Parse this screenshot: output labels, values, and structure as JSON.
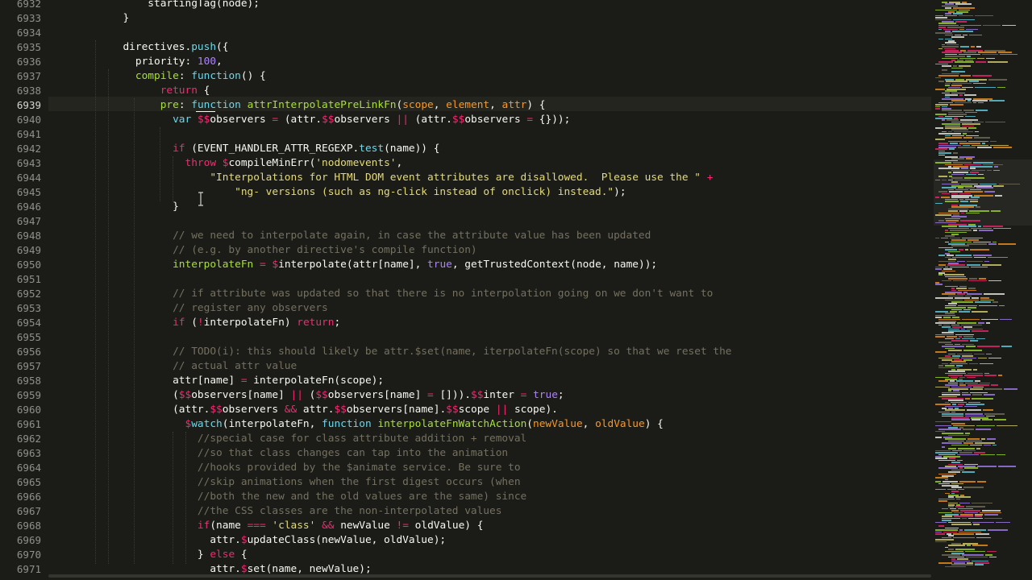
{
  "editor": {
    "active_line": "6939",
    "lines": [
      {
        "n": "6932",
        "t": [
          [
            "                ",
            "t-sel"
          ],
          [
            "startingTag(node);",
            ""
          ]
        ]
      },
      {
        "n": "6933",
        "t": [
          [
            "            }",
            ""
          ]
        ]
      },
      {
        "n": "6934",
        "t": []
      },
      {
        "n": "6935",
        "t": [
          [
            "            directives.",
            ""
          ],
          [
            "push",
            "t-sk"
          ],
          [
            "({",
            ""
          ]
        ]
      },
      {
        "n": "6936",
        "t": [
          [
            "              priority: ",
            ""
          ],
          [
            "100",
            "t-nu"
          ],
          [
            ",",
            ""
          ]
        ]
      },
      {
        "n": "6937",
        "t": [
          [
            "              ",
            ""
          ],
          [
            "compile",
            "t-fn"
          ],
          [
            ": ",
            ""
          ],
          [
            "function",
            "t-sk"
          ],
          [
            "() {",
            ""
          ]
        ]
      },
      {
        "n": "6938",
        "t": [
          [
            "                  ",
            ""
          ],
          [
            "return",
            "t-kw"
          ],
          [
            " {",
            ""
          ]
        ]
      },
      {
        "n": "6939",
        "t": [
          [
            "                  ",
            ""
          ],
          [
            "pre",
            "t-fn"
          ],
          [
            ": ",
            ""
          ],
          [
            "function",
            "t-sk"
          ],
          [
            " ",
            ""
          ],
          [
            "attrInterpolatePreLinkFn",
            "t-fn"
          ],
          [
            "(",
            ""
          ],
          [
            "scope",
            "t-pa"
          ],
          [
            ", ",
            ""
          ],
          [
            "element",
            "t-pa"
          ],
          [
            ", ",
            ""
          ],
          [
            "attr",
            "t-pa"
          ],
          [
            ") {",
            ""
          ]
        ]
      },
      {
        "n": "6940",
        "t": [
          [
            "                    ",
            ""
          ],
          [
            "var",
            "t-sk"
          ],
          [
            " ",
            ""
          ],
          [
            "$$",
            "t-kw"
          ],
          [
            "observers ",
            ""
          ],
          [
            "=",
            "t-kw"
          ],
          [
            " (attr.",
            ""
          ],
          [
            "$$",
            "t-kw"
          ],
          [
            "observers ",
            ""
          ],
          [
            "||",
            "t-kw"
          ],
          [
            " (attr.",
            ""
          ],
          [
            "$$",
            "t-kw"
          ],
          [
            "observers ",
            ""
          ],
          [
            "=",
            "t-kw"
          ],
          [
            " {}));",
            ""
          ]
        ]
      },
      {
        "n": "6941",
        "t": []
      },
      {
        "n": "6942",
        "t": [
          [
            "                    ",
            ""
          ],
          [
            "if",
            "t-kw"
          ],
          [
            " (EVENT_HANDLER_ATTR_REGEXP.",
            ""
          ],
          [
            "test",
            "t-sk"
          ],
          [
            "(name)) {",
            ""
          ]
        ]
      },
      {
        "n": "6943",
        "t": [
          [
            "                      ",
            ""
          ],
          [
            "throw",
            "t-kw"
          ],
          [
            " ",
            ""
          ],
          [
            "$",
            "t-kw"
          ],
          [
            "compileMinErr(",
            ""
          ],
          [
            "'nodomevents'",
            "t-st"
          ],
          [
            ",",
            ""
          ]
        ]
      },
      {
        "n": "6944",
        "t": [
          [
            "                          ",
            ""
          ],
          [
            "\"Interpolations for HTML DOM event attributes are disallowed.  Please use the \"",
            "t-st"
          ],
          [
            " ",
            ""
          ],
          [
            "+",
            "t-kw"
          ]
        ]
      },
      {
        "n": "6945",
        "t": [
          [
            "                              ",
            ""
          ],
          [
            "\"ng- versions (such as ng-click instead of onclick) instead.\"",
            "t-st"
          ],
          [
            ");",
            ""
          ]
        ]
      },
      {
        "n": "6946",
        "t": [
          [
            "                    }",
            ""
          ]
        ]
      },
      {
        "n": "6947",
        "t": []
      },
      {
        "n": "6948",
        "t": [
          [
            "                    ",
            ""
          ],
          [
            "// we need to interpolate again, in case the attribute value has been updated",
            "t-cm"
          ]
        ]
      },
      {
        "n": "6949",
        "t": [
          [
            "                    ",
            ""
          ],
          [
            "// (e.g. by another directive's compile function)",
            "t-cm"
          ]
        ]
      },
      {
        "n": "6950",
        "t": [
          [
            "                    ",
            ""
          ],
          [
            "interpolateFn",
            "t-fn"
          ],
          [
            " ",
            ""
          ],
          [
            "=",
            "t-kw"
          ],
          [
            " ",
            ""
          ],
          [
            "$",
            "t-kw"
          ],
          [
            "interpolate(attr[name], ",
            ""
          ],
          [
            "true",
            "t-nu"
          ],
          [
            ", getTrustedContext(node, name));",
            ""
          ]
        ]
      },
      {
        "n": "6951",
        "t": []
      },
      {
        "n": "6952",
        "t": [
          [
            "                    ",
            ""
          ],
          [
            "// if attribute was updated so that there is no interpolation going on we don't want to",
            "t-cm"
          ]
        ]
      },
      {
        "n": "6953",
        "t": [
          [
            "                    ",
            ""
          ],
          [
            "// register any observers",
            "t-cm"
          ]
        ]
      },
      {
        "n": "6954",
        "t": [
          [
            "                    ",
            ""
          ],
          [
            "if",
            "t-kw"
          ],
          [
            " (",
            ""
          ],
          [
            "!",
            "t-kw"
          ],
          [
            "interpolateFn) ",
            ""
          ],
          [
            "return",
            "t-kw"
          ],
          [
            ";",
            ""
          ]
        ]
      },
      {
        "n": "6955",
        "t": []
      },
      {
        "n": "6956",
        "t": [
          [
            "                    ",
            ""
          ],
          [
            "// TODO(i): this should likely be attr.$set(name, iterpolateFn(scope) so that we reset the",
            "t-cm"
          ]
        ]
      },
      {
        "n": "6957",
        "t": [
          [
            "                    ",
            ""
          ],
          [
            "// actual attr value",
            "t-cm"
          ]
        ]
      },
      {
        "n": "6958",
        "t": [
          [
            "                    attr[name] ",
            ""
          ],
          [
            "=",
            "t-kw"
          ],
          [
            " interpolateFn(scope);",
            ""
          ]
        ]
      },
      {
        "n": "6959",
        "t": [
          [
            "                    (",
            ""
          ],
          [
            "$$",
            "t-kw"
          ],
          [
            "observers[name] ",
            ""
          ],
          [
            "||",
            "t-kw"
          ],
          [
            " (",
            ""
          ],
          [
            "$$",
            "t-kw"
          ],
          [
            "observers[name] ",
            ""
          ],
          [
            "=",
            "t-kw"
          ],
          [
            " [])).",
            ""
          ],
          [
            "$$",
            "t-kw"
          ],
          [
            "inter ",
            ""
          ],
          [
            "=",
            "t-kw"
          ],
          [
            " ",
            ""
          ],
          [
            "true",
            "t-nu"
          ],
          [
            ";",
            ""
          ]
        ]
      },
      {
        "n": "6960",
        "t": [
          [
            "                    (attr.",
            ""
          ],
          [
            "$$",
            "t-kw"
          ],
          [
            "observers ",
            ""
          ],
          [
            "&&",
            "t-kw"
          ],
          [
            " attr.",
            ""
          ],
          [
            "$$",
            "t-kw"
          ],
          [
            "observers[name].",
            ""
          ],
          [
            "$$",
            "t-kw"
          ],
          [
            "scope ",
            ""
          ],
          [
            "||",
            "t-kw"
          ],
          [
            " scope).",
            ""
          ]
        ]
      },
      {
        "n": "6961",
        "t": [
          [
            "                      ",
            ""
          ],
          [
            "$",
            "t-kw"
          ],
          [
            "watch",
            "t-sk"
          ],
          [
            "(interpolateFn, ",
            ""
          ],
          [
            "function",
            "t-sk"
          ],
          [
            " ",
            ""
          ],
          [
            "interpolateFnWatchAction",
            "t-fn"
          ],
          [
            "(",
            ""
          ],
          [
            "newValue",
            "t-pa"
          ],
          [
            ", ",
            ""
          ],
          [
            "oldValue",
            "t-pa"
          ],
          [
            ") {",
            ""
          ]
        ]
      },
      {
        "n": "6962",
        "t": [
          [
            "                        ",
            ""
          ],
          [
            "//special case for class attribute addition + removal",
            "t-cm"
          ]
        ]
      },
      {
        "n": "6963",
        "t": [
          [
            "                        ",
            ""
          ],
          [
            "//so that class changes can tap into the animation",
            "t-cm"
          ]
        ]
      },
      {
        "n": "6964",
        "t": [
          [
            "                        ",
            ""
          ],
          [
            "//hooks provided by the $animate service. Be sure to",
            "t-cm"
          ]
        ]
      },
      {
        "n": "6965",
        "t": [
          [
            "                        ",
            ""
          ],
          [
            "//skip animations when the first digest occurs (when",
            "t-cm"
          ]
        ]
      },
      {
        "n": "6966",
        "t": [
          [
            "                        ",
            ""
          ],
          [
            "//both the new and the old values are the same) since",
            "t-cm"
          ]
        ]
      },
      {
        "n": "6967",
        "t": [
          [
            "                        ",
            ""
          ],
          [
            "//the CSS classes are the non-interpolated values",
            "t-cm"
          ]
        ]
      },
      {
        "n": "6968",
        "t": [
          [
            "                        ",
            ""
          ],
          [
            "if",
            "t-kw"
          ],
          [
            "(name ",
            ""
          ],
          [
            "===",
            "t-kw"
          ],
          [
            " ",
            ""
          ],
          [
            "'class'",
            "t-st"
          ],
          [
            " ",
            ""
          ],
          [
            "&&",
            "t-kw"
          ],
          [
            " newValue ",
            ""
          ],
          [
            "!=",
            "t-kw"
          ],
          [
            " oldValue) {",
            ""
          ]
        ]
      },
      {
        "n": "6969",
        "t": [
          [
            "                          attr.",
            ""
          ],
          [
            "$",
            "t-kw"
          ],
          [
            "updateClass(newValue, oldValue);",
            ""
          ]
        ]
      },
      {
        "n": "6970",
        "t": [
          [
            "                        } ",
            ""
          ],
          [
            "else",
            "t-kw"
          ],
          [
            " {",
            ""
          ]
        ]
      },
      {
        "n": "6971",
        "t": [
          [
            "                          attr.",
            ""
          ],
          [
            "$",
            "t-kw"
          ],
          [
            "set(name, newValue);",
            ""
          ]
        ]
      }
    ]
  },
  "minimap": {
    "colors": [
      "#f8f8f2",
      "#a6e22e",
      "#66d9ef",
      "#f92672",
      "#e6db74",
      "#75715e",
      "#ae81ff",
      "#fd971f"
    ]
  }
}
